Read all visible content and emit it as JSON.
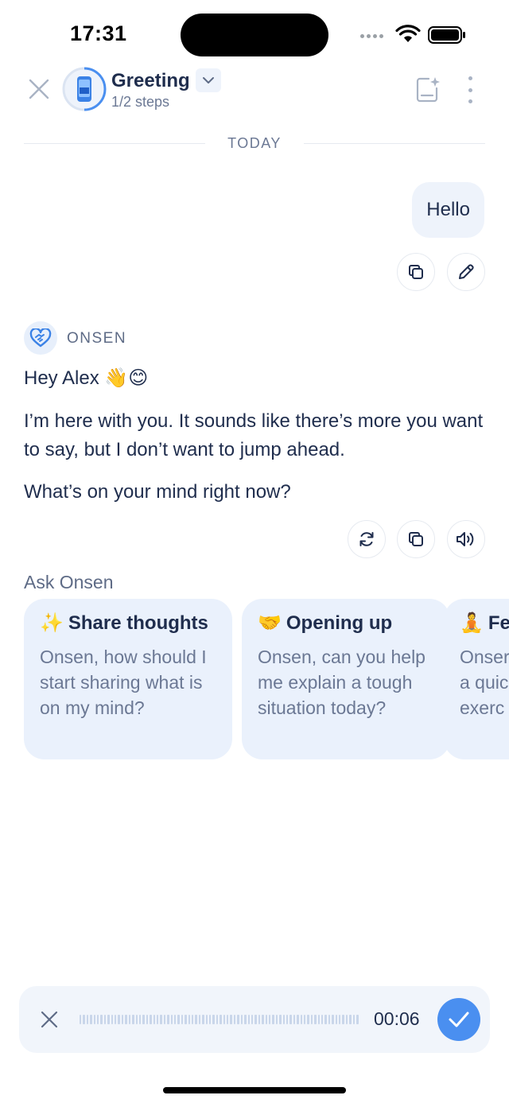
{
  "status_bar": {
    "time": "17:31"
  },
  "header": {
    "title": "Greeting",
    "subtitle": "1/2 steps",
    "progress": 0.5
  },
  "divider": {
    "label": "TODAY"
  },
  "user_message": {
    "text": "Hello"
  },
  "assistant": {
    "name": "ONSEN",
    "greeting": "Hey Alex 👋😊",
    "paragraph_1": "I’m here with you. It sounds like there’s more you want to say, but I don’t want to jump ahead.",
    "paragraph_2": "What’s on your mind right now?"
  },
  "ask": {
    "title": "Ask Onsen",
    "cards": [
      {
        "emoji": "✨",
        "title": "Share thoughts",
        "body": "Onsen, how should I start sharing what is on my mind?"
      },
      {
        "emoji": "🤝",
        "title": "Opening up",
        "body": "Onsen, can you help me explain a tough situation today?"
      },
      {
        "emoji": "🧘",
        "title": "Fe",
        "body": "Onser a quic exerc"
      }
    ]
  },
  "recorder": {
    "timer": "00:06"
  },
  "colors": {
    "accent": "#4a8ff0",
    "card_bg": "#eaf1fc",
    "text": "#1f2d4d",
    "muted": "#6b7894"
  }
}
